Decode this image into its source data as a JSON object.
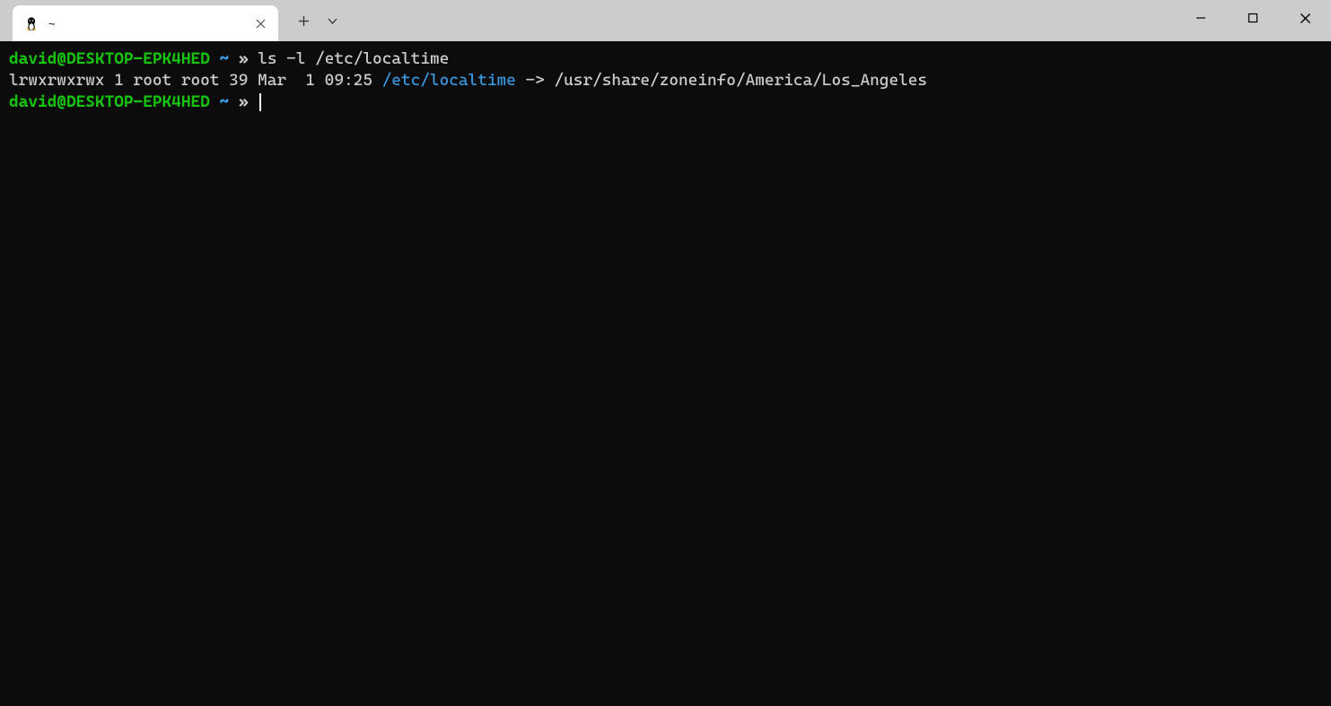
{
  "titlebar": {
    "tab_title": "~"
  },
  "terminal": {
    "line1": {
      "user_host": "david@DESKTOP-EPK4HED",
      "cwd": "~",
      "symbol": "»",
      "command": "ls -l /etc/localtime"
    },
    "line2": {
      "perms_info": "lrwxrwxrwx 1 root root 39 Mar  1 09:25 ",
      "symlink_name": "/etc/localtime",
      "arrow": " -> ",
      "target": "/usr/share/zoneinfo/America/Los_Angeles"
    },
    "line3": {
      "user_host": "david@DESKTOP-EPK4HED",
      "cwd": "~",
      "symbol": "»"
    }
  }
}
